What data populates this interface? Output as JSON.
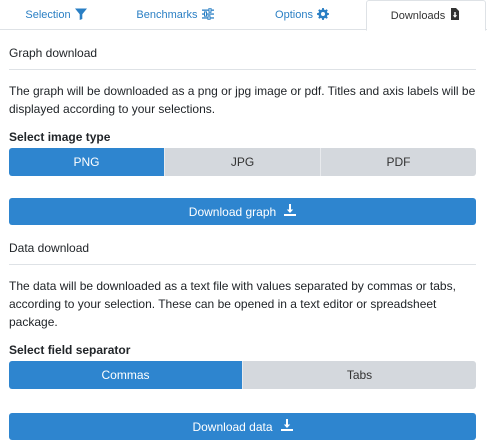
{
  "tabs": [
    {
      "label": "Selection",
      "icon": "filter-icon"
    },
    {
      "label": "Benchmarks",
      "icon": "sliders-icon"
    },
    {
      "label": "Options",
      "icon": "gear-icon"
    },
    {
      "label": "Downloads",
      "icon": "file-download-icon",
      "active": true
    }
  ],
  "graph": {
    "title": "Graph download",
    "description": "The graph will be downloaded as a png or jpg image or pdf. Titles and axis labels will be displayed according to your selections.",
    "type_label": "Select image type",
    "types": [
      "PNG",
      "JPG",
      "PDF"
    ],
    "selected_type": "PNG",
    "button_label": "Download graph"
  },
  "data": {
    "title": "Data download",
    "description": "The data will be downloaded as a text file with values separated by commas or tabs, according to your selection. These can be opened in a text editor or spreadsheet package.",
    "separator_label": "Select field separator",
    "separators": [
      "Commas",
      "Tabs"
    ],
    "selected_separator": "Commas",
    "button_label": "Download data"
  },
  "colors": {
    "accent": "#2e85cf",
    "link": "#2a7fc4",
    "inactive": "#d4d8dd"
  }
}
